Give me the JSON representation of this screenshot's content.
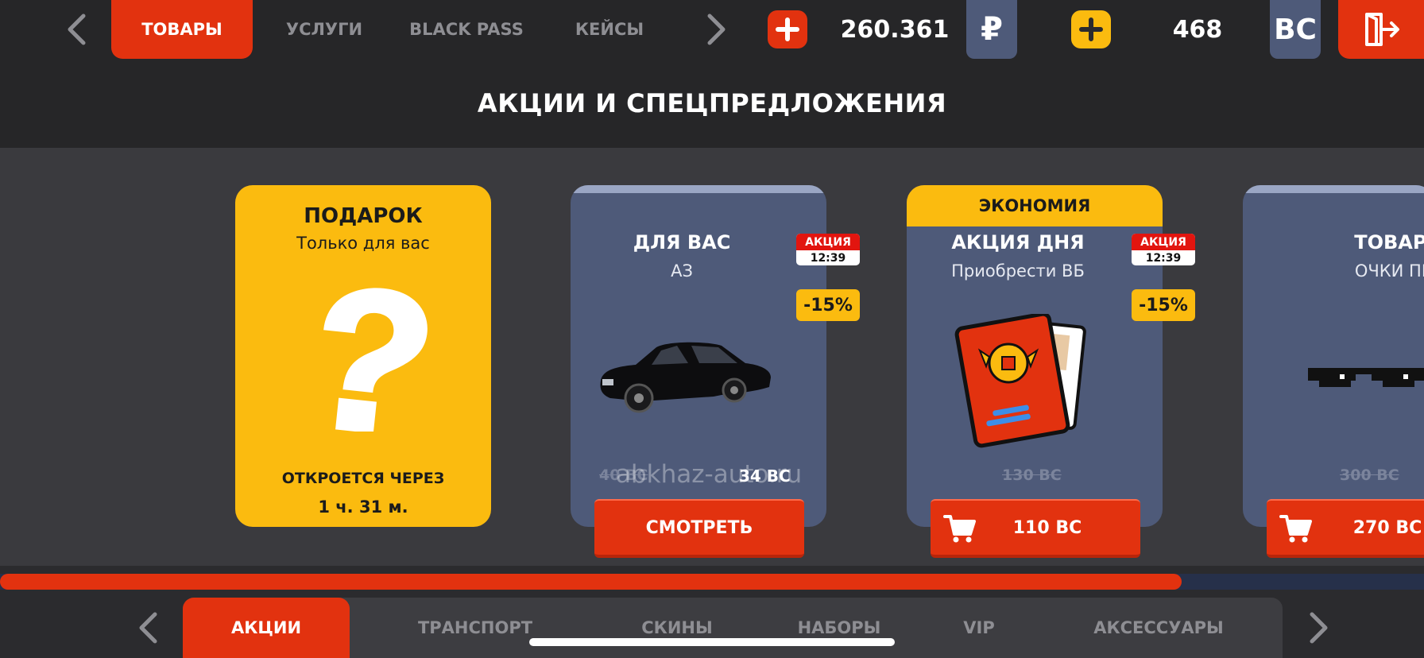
{
  "header": {
    "tabs": [
      {
        "label": "ТОВАРЫ",
        "active": true
      },
      {
        "label": "УСЛУГИ",
        "active": false
      },
      {
        "label": "BLACK PASS",
        "active": false
      },
      {
        "label": "КЕЙСЫ",
        "active": false
      }
    ],
    "rub_balance": "260.361",
    "rub_symbol": "₽",
    "bc_balance": "468",
    "bc_label": "BC",
    "icons": {
      "prev": "chevron-left-icon",
      "next": "chevron-right-icon",
      "add": "plus-icon",
      "exit": "exit-door-icon"
    }
  },
  "section": {
    "title": "АКЦИИ И СПЕЦПРЕДЛОЖЕНИЯ"
  },
  "cards": {
    "gift": {
      "title": "ПОДАРОК",
      "subtitle": "Только для вас",
      "opens_label": "ОТКРОЕТСЯ ЧЕРЕЗ",
      "opens_time": "1 ч. 31 м."
    },
    "offer1": {
      "title": "ДЛЯ ВАС",
      "subtitle": "АЗ",
      "promo_label": "АКЦИЯ",
      "promo_time": "12:39",
      "discount": "-15%",
      "old_price": "40 BC",
      "new_price": "34 BC",
      "button": "СМОТРЕТЬ"
    },
    "offer2": {
      "banner": "ЭКОНОМИЯ",
      "title": "АКЦИЯ ДНЯ",
      "subtitle": "Приобрести ВБ",
      "promo_label": "АКЦИЯ",
      "promo_time": "12:39",
      "discount": "-15%",
      "old_price": "130 BC",
      "button": "110 BC"
    },
    "offer3": {
      "title": "ТОВАР ДНЯ",
      "subtitle": "ОЧКИ ПИКСЕЛ",
      "old_price": "300 BC",
      "button": "270 BC"
    }
  },
  "watermark": "abkhaz-auto.ru",
  "scroll": {
    "progress": 0.83
  },
  "bottom_nav": {
    "tabs": [
      {
        "label": "АКЦИИ",
        "active": true
      },
      {
        "label": "ТРАНСПОРТ",
        "active": false
      },
      {
        "label": "СКИНЫ",
        "active": false
      },
      {
        "label": "НАБОРЫ",
        "active": false
      },
      {
        "label": "VIP",
        "active": false
      },
      {
        "label": "АКСЕССУАРЫ",
        "active": false
      }
    ]
  },
  "colors": {
    "accent": "#e2320f",
    "gold": "#fbbb0f",
    "card": "#4e5a79",
    "background": "#3a3a3e"
  }
}
